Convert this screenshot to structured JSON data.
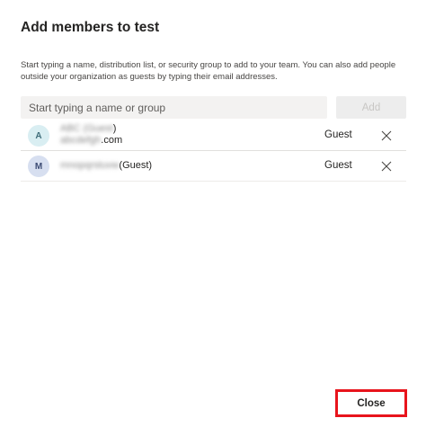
{
  "dialog": {
    "title": "Add members to test",
    "description": "Start typing a name, distribution list, or security group to add to your team. You can also add people outside your organization as guests by typing their email addresses."
  },
  "search": {
    "placeholder": "Start typing a name or group",
    "add_label": "Add"
  },
  "members": [
    {
      "initial": "A",
      "name_blurred": "ABC (Guest",
      "name_suffix": ")",
      "email_blurred": "abcdefgh",
      "email_suffix": ".com",
      "role": "Guest"
    },
    {
      "initial": "M",
      "name_blurred": "mnopqrstuvw",
      "name_suffix": "(Guest)",
      "role": "Guest"
    }
  ],
  "footer": {
    "close_label": "Close"
  },
  "colors": {
    "highlight": "#e8141c"
  },
  "icons": {
    "remove": "close-icon"
  }
}
